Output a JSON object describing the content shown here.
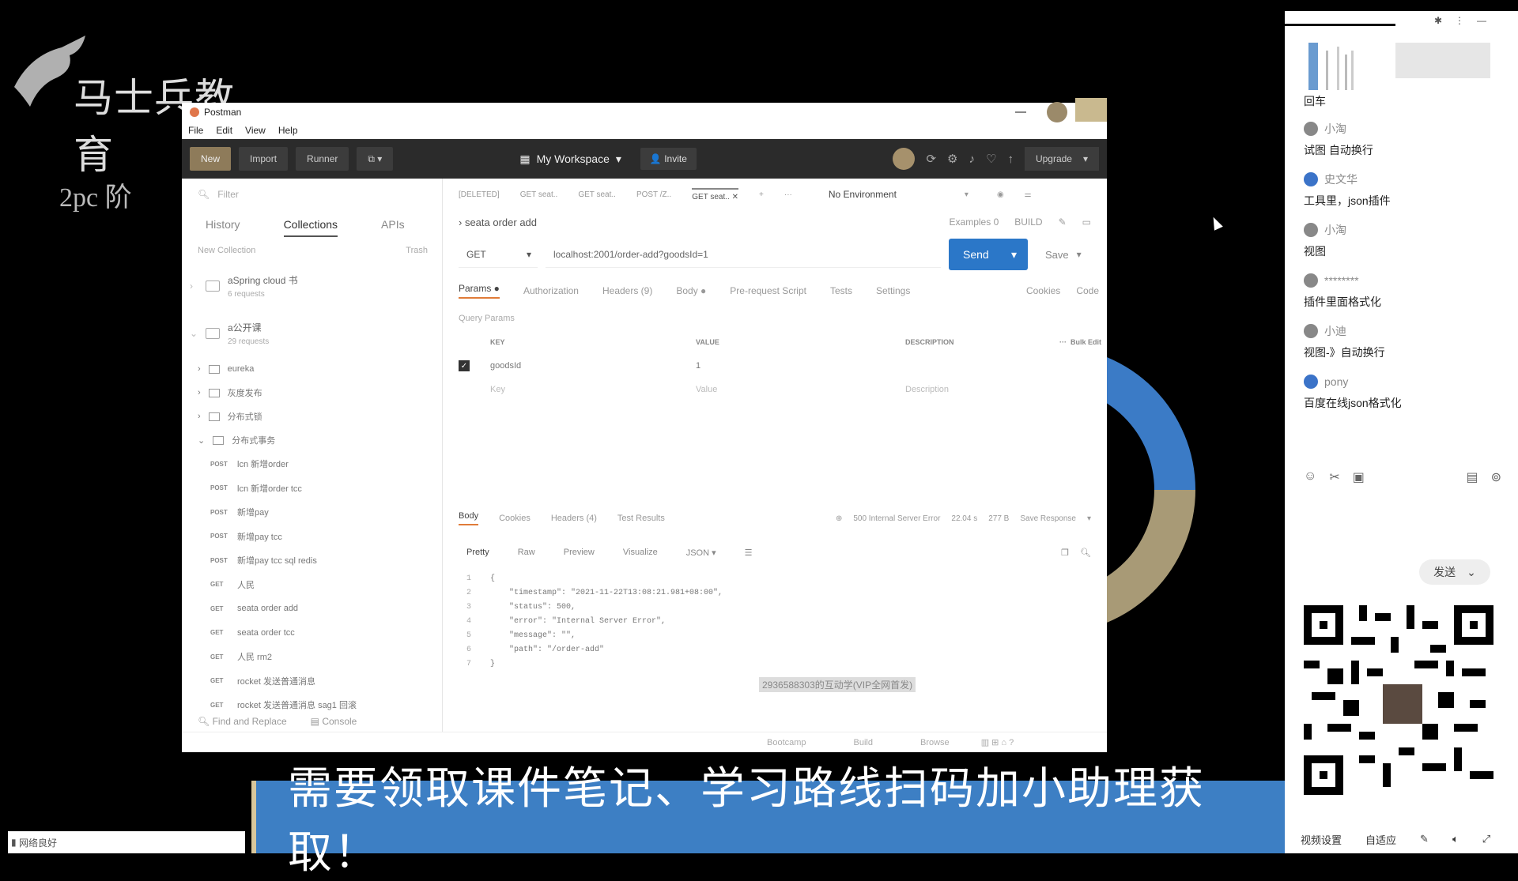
{
  "brand": {
    "logo_text": "马士兵教育",
    "slide_text": "2pc   阶"
  },
  "postman": {
    "title": "Postman",
    "menu": [
      "File",
      "Edit",
      "View",
      "Help"
    ],
    "toolbar": {
      "new": "New",
      "import": "Import",
      "runner": "Runner",
      "workspace": "My Workspace",
      "invite": "Invite",
      "upgrade": "Upgrade"
    },
    "sidebar": {
      "filter_placeholder": "Filter",
      "tabs": [
        "History",
        "Collections",
        "APIs"
      ],
      "new_collection": "New Collection",
      "trash": "Trash",
      "collections": [
        {
          "name": "aSpring cloud 书",
          "count": "6 requests"
        },
        {
          "name": "a公开课",
          "count": "29 requests"
        }
      ],
      "folders": [
        "eureka",
        "灰度发布",
        "分布式锁",
        "分布式事务"
      ],
      "requests": [
        {
          "method": "POST",
          "name": "lcn 新增order"
        },
        {
          "method": "POST",
          "name": "lcn 新增order tcc"
        },
        {
          "method": "POST",
          "name": "新增pay"
        },
        {
          "method": "POST",
          "name": "新增pay tcc"
        },
        {
          "method": "POST",
          "name": "新增pay tcc sql redis"
        },
        {
          "method": "GET",
          "name": "人民"
        },
        {
          "method": "GET",
          "name": "seata order add"
        },
        {
          "method": "GET",
          "name": "seata order tcc"
        },
        {
          "method": "GET",
          "name": "人民 rm2"
        },
        {
          "method": "GET",
          "name": "rocket 发送普通消息"
        },
        {
          "method": "GET",
          "name": "rocket 发送普通消息 sag1 回滚"
        }
      ],
      "find_replace": "Find and Replace",
      "console": "Console"
    },
    "request_tabs": [
      "[DELETED]",
      "GET seat..",
      "GET seat..",
      "POST /Z..",
      "GET seat.."
    ],
    "environment": "No Environment",
    "request_name": "seata order add",
    "examples": "Examples  0",
    "build": "BUILD",
    "method": "GET",
    "url": "localhost:2001/order-add?goodsId=1",
    "send": "Send",
    "save": "Save",
    "subtabs": [
      "Params ●",
      "Authorization",
      "Headers (9)",
      "Body ●",
      "Pre-request Script",
      "Tests",
      "Settings"
    ],
    "cookies": "Cookies",
    "code_link": "Code",
    "query_params": "Query Params",
    "kv_head": {
      "key": "KEY",
      "value": "VALUE",
      "desc": "DESCRIPTION",
      "bulk": "Bulk Edit"
    },
    "param": {
      "key": "goodsId",
      "value": "1"
    },
    "placeholder": {
      "key": "Key",
      "value": "Value",
      "desc": "Description"
    },
    "response_tabs": [
      "Body",
      "Cookies",
      "Headers (4)",
      "Test Results"
    ],
    "response_status": {
      "code": "500 Internal Server Error",
      "time": "22.04 s",
      "size": "277 B",
      "save": "Save Response"
    },
    "format_tabs": [
      "Pretty",
      "Raw",
      "Preview",
      "Visualize",
      "JSON"
    ],
    "code_lines": [
      "{",
      "    \"timestamp\": \"2021-11-22T13:08:21.981+08:00\",",
      "    \"status\": 500,",
      "    \"error\": \"Internal Server Error\",",
      "    \"message\": \"\",",
      "    \"path\": \"/order-add\"",
      "}"
    ],
    "watermark_small": "2936588303的互动学(VIP全网首发)",
    "status_bar": [
      "Bootcamp",
      "Build",
      "Browse"
    ]
  },
  "chat": {
    "top_label": "回车",
    "messages": [
      {
        "user": "小淘",
        "text": "试图 自动换行"
      },
      {
        "user": "史文华",
        "text": "工具里，json插件"
      },
      {
        "user": "小淘",
        "text": "视图"
      },
      {
        "user": "********",
        "text": "插件里面格式化"
      },
      {
        "user": "小迪",
        "text": "视图-》自动换行"
      },
      {
        "user": "pony",
        "text": "百度在线json格式化"
      }
    ],
    "send": "发送",
    "bottom": [
      "视频设置",
      "自适应"
    ]
  },
  "banner": "需要领取课件笔记、学习路线扫码加小助理获取！",
  "network": "网络良好",
  "colors": {
    "send_blue": "#2b77c8",
    "banner_blue": "#3d7fc4",
    "donut_blue": "#3b7bc6",
    "donut_tan": "#a89a76"
  }
}
